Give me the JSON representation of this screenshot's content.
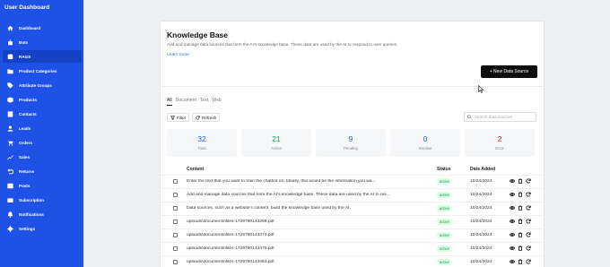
{
  "sidebar": {
    "title": "User Dashboard",
    "items": [
      {
        "label": "Dashboard",
        "icon": "home-icon"
      },
      {
        "label": "Bots",
        "icon": "bot-icon"
      },
      {
        "label": "RAGS",
        "icon": "database-icon",
        "active": true
      },
      {
        "label": "Product Categories",
        "icon": "folder-icon"
      },
      {
        "label": "Attribute Groups",
        "icon": "tag-icon"
      },
      {
        "label": "Products",
        "icon": "box-icon"
      },
      {
        "label": "Contacts",
        "icon": "contact-icon"
      },
      {
        "label": "Leads",
        "icon": "user-icon"
      },
      {
        "label": "Orders",
        "icon": "cart-icon"
      },
      {
        "label": "Sales",
        "icon": "chart-icon"
      },
      {
        "label": "Returns",
        "icon": "return-icon"
      },
      {
        "label": "Posts",
        "icon": "post-icon"
      },
      {
        "label": "Subscription",
        "icon": "card-icon"
      },
      {
        "label": "Notifications",
        "icon": "bell-icon"
      },
      {
        "label": "Settings",
        "icon": "gear-icon"
      }
    ]
  },
  "main": {
    "title": "Knowledge Base",
    "description": "Add and manage data sources that form the AI's knowledge base. These data are used by the AI to respond to user queries.",
    "learn_more": "Learn more",
    "new_button": "+ New Data Source",
    "tabs": [
      "All",
      "Document",
      "Text",
      "Web"
    ],
    "filter_label": "Filter",
    "refresh_label": "Refresh",
    "search_placeholder": "Search data sources",
    "stats": [
      {
        "value": "32",
        "label": "Total",
        "color": "#2563eb"
      },
      {
        "value": "21",
        "label": "Active",
        "color": "#16a34a"
      },
      {
        "value": "9",
        "label": "Pending",
        "color": "#2563eb"
      },
      {
        "value": "0",
        "label": "Inactive",
        "color": "#2563eb"
      },
      {
        "value": "2",
        "label": "Error",
        "color": "#dc2626"
      }
    ],
    "table": {
      "headers": {
        "content": "Content",
        "status": "Status",
        "date": "Date Added"
      },
      "rows": [
        {
          "content": "Enter the text that you want to train the chatbot on. Ideally, this would be the information you wa...",
          "status": "active",
          "date": "10/24/2024"
        },
        {
          "content": "Add and manage data sources that form the AI's knowledge base. These data are used by the AI to res...",
          "status": "active",
          "date": "10/24/2024"
        },
        {
          "content": "Data sources, such as a website's content, build the knowledge base used by the AI.",
          "status": "active",
          "date": "10/24/2024"
        },
        {
          "content": "uploads\\documents\\files-1729790143298.pdf",
          "status": "active",
          "date": "10/24/2024"
        },
        {
          "content": "uploads\\documents\\files-1729790143374.pdf",
          "status": "active",
          "date": "10/24/2024"
        },
        {
          "content": "uploads\\documents\\files-1729790143476.pdf",
          "status": "active",
          "date": "10/24/2024"
        },
        {
          "content": "uploads\\documents\\files-1729790143483.pdf",
          "status": "active",
          "date": "10/24/2024"
        }
      ]
    }
  },
  "colors": {
    "sidebar": "#1e52e6",
    "sidebar_active": "#1541c4",
    "primary_button": "#0d0d0d",
    "link": "#2b6df0"
  }
}
